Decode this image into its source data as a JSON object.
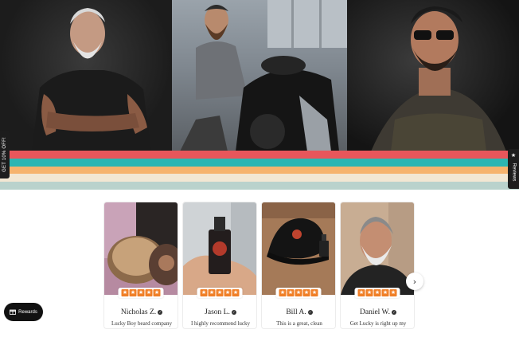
{
  "hero": {
    "panels": [
      {
        "name": "hero-image-silver-beard-man"
      },
      {
        "name": "hero-image-motorcycle-man"
      },
      {
        "name": "hero-image-sunglasses-man"
      }
    ]
  },
  "stripes": [
    "#e8565b",
    "#2cb5b2",
    "#f6b36d",
    "#f2e7d3",
    "#b9d2cc"
  ],
  "side_tab_left": {
    "label": "GET 10% OFF!"
  },
  "side_tab_right": {
    "label": "Reviews",
    "icon": "star-icon"
  },
  "reviews": [
    {
      "name": "Nicholas Z.",
      "text": "Lucky Boy beard company",
      "rating": 5
    },
    {
      "name": "Jason L.",
      "text": "I highly recommend lucky",
      "rating": 5
    },
    {
      "name": "Bill A.",
      "text": "This is a great, clean",
      "rating": 5
    },
    {
      "name": "Daniel W.",
      "text": "Get Lucky is right up my",
      "rating": 5
    }
  ],
  "carousel": {
    "next_icon": "chevron-right-icon",
    "next_glyph": "›"
  },
  "rewards": {
    "label": "Rewards",
    "icon": "gift-icon"
  },
  "colors": {
    "star": "#f07f27",
    "dark": "#111111"
  }
}
